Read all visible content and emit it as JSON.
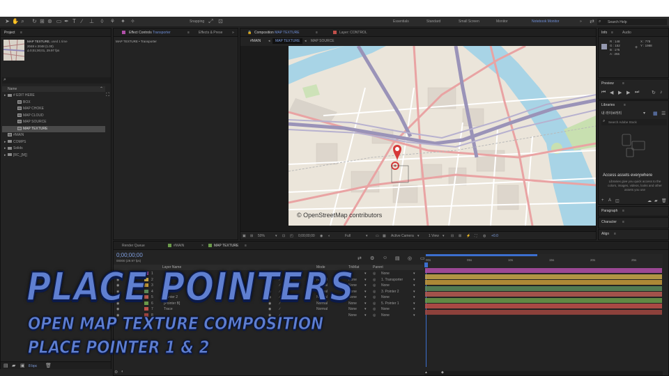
{
  "workspace": {
    "snapping": "Snapping",
    "items": [
      "Essentials",
      "Standard",
      "Small Screen",
      "Monitor",
      "Notebook Monitor"
    ],
    "search_placeholder": "Search Help"
  },
  "project_panel": {
    "tab": "Project",
    "item_name": "MAP TEXTURE",
    "item_used": ", used 1 time",
    "item_size": "2048 x 2048 (1.00)",
    "item_duration": "Δ 0;01;00;01, 29.97 fps",
    "column_name": "Name",
    "tree": [
      {
        "label": "# EDIT HERE",
        "kind": "folder",
        "depth": 0
      },
      {
        "label": "BOX",
        "kind": "comp",
        "depth": 1
      },
      {
        "label": "MAP CHOKE",
        "kind": "comp",
        "depth": 1
      },
      {
        "label": "MAP CLOUD",
        "kind": "comp",
        "depth": 1
      },
      {
        "label": "MAP SOURCE",
        "kind": "comp",
        "depth": 1
      },
      {
        "label": "MAP TEXTURE",
        "kind": "comp",
        "depth": 1,
        "selected": true
      },
      {
        "label": "#MAIN",
        "kind": "comp",
        "depth": 0
      },
      {
        "label": "COMPS",
        "kind": "folder",
        "depth": 0
      },
      {
        "label": "Solids",
        "kind": "folder",
        "depth": 0
      },
      {
        "label": "[RC_[M]]",
        "kind": "folder",
        "depth": 0
      }
    ],
    "bpc": "8 bpc"
  },
  "effect_controls": {
    "tab": "Effect Controls",
    "tab_layer": "Transporter",
    "tab2": "Effects & Prese",
    "subtitle": "MAP TEXTURE • Transporter"
  },
  "composition": {
    "tab": "Composition",
    "tab_name": "MAP TEXTURE",
    "layer_tab": "Layer: CONTROL",
    "breadcrumbs": [
      "#MAIN",
      "MAP TEXTURE",
      "MAP SOURCE"
    ],
    "attribution": "© OpenStreetMap contributors",
    "zoom": "50%",
    "timecode": "0;00;00;00",
    "resolution": "Full",
    "camera": "Active Camera",
    "view": "1 View",
    "offset": "+0.0"
  },
  "info": {
    "tab": "Info",
    "tab2": "Audio",
    "r": "R : 148",
    "g": "G : 152",
    "b": "B : 175",
    "a": "A : 255",
    "x": "X : 778",
    "y": "Y : 1988"
  },
  "preview": {
    "label": "Preview"
  },
  "libraries": {
    "label": "Libraries",
    "library_name": "내 라이브러리",
    "search_placeholder": "Search Adobe Stock",
    "heading": "Access assets everywhere",
    "body": "Libraries give you quick access to the colors, images, videos, looks and other assets you use"
  },
  "side_sections": [
    "Paragraph",
    "Character",
    "Align"
  ],
  "timeline": {
    "tabs": [
      "Render Queue",
      "#MAIN",
      "MAP TEXTURE"
    ],
    "time": "0;00;00;00",
    "fps": "00000 (29.97 fps)",
    "col_layer": "Layer Name",
    "col_mode": "Mode",
    "col_trkmat": "TrkMat",
    "col_parent": "Parent",
    "ticks": [
      "00s",
      "05s",
      "10s",
      "15s",
      "20s",
      "25s"
    ],
    "layers": [
      {
        "num": "1",
        "name": "",
        "mode": "",
        "trk": "",
        "parent": "None",
        "color": "#b04fa8"
      },
      {
        "num": "2",
        "name": "",
        "mode": "Normal",
        "trk": "None",
        "parent": "1. Transporter",
        "color": "#c9a84a"
      },
      {
        "num": "3",
        "name": "Pointer",
        "mode": "Normal",
        "trk": "None",
        "parent": "None",
        "color": "#c59a3a"
      },
      {
        "num": "4",
        "name": "Pointer",
        "mode": "Normal",
        "trk": "None",
        "parent": "3. Pointer 2",
        "color": "#5a8a5a"
      },
      {
        "num": "5",
        "name": "Pointer 2",
        "mode": "Normal",
        "trk": "None",
        "parent": "None",
        "color": "#b85a52"
      },
      {
        "num": "6",
        "name": "[Pointer B]",
        "mode": "Normal",
        "trk": "None",
        "parent": "5. Pointer 1",
        "color": "#6b9b4a"
      },
      {
        "num": "7",
        "name": "Trace",
        "mode": "Normal",
        "trk": "None",
        "parent": "None",
        "color": "#c0504a"
      },
      {
        "num": "8",
        "name": "",
        "mode": "",
        "trk": "None",
        "parent": "None",
        "color": "#a04640"
      }
    ]
  },
  "overlay": {
    "title": "PLACE POINTERS",
    "line1": "OPEN MAP TEXTURE COMPOSITION",
    "line2": "PLACE POINTER 1 & 2"
  }
}
